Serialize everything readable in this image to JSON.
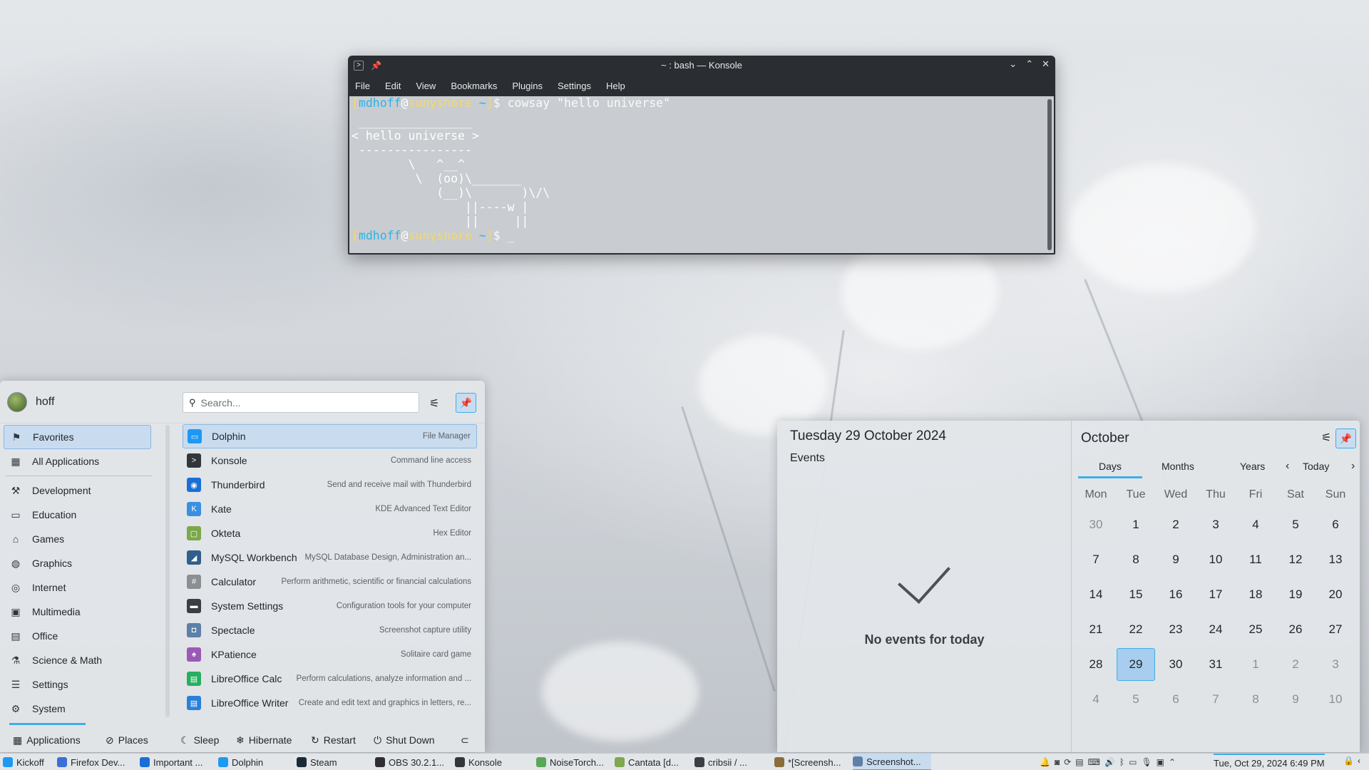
{
  "konsole": {
    "title": "~ : bash — Konsole",
    "menu": [
      "File",
      "Edit",
      "View",
      "Bookmarks",
      "Plugins",
      "Settings",
      "Help"
    ],
    "prompt": {
      "open": "[",
      "user": "mdhoff",
      "at": "@",
      "host": "sunyshore",
      "path": "~",
      "close": "]",
      "dollar": "$"
    },
    "command": " cowsay \"hello universe\"",
    "output": " ________________\n< hello universe >\n ----------------\n        \\   ^__^\n         \\  (oo)\\_______\n            (__)\\       )\\/\\\n                ||----w |\n                ||     ||",
    "cursor": " _"
  },
  "kickoff": {
    "user": "hoff",
    "search_placeholder": "Search...",
    "categories": [
      {
        "label": "Favorites",
        "icon": "bookmark-icon",
        "glyph": "⚑"
      },
      {
        "label": "All Applications",
        "icon": "grid-icon",
        "glyph": "▦"
      },
      {
        "label": "Development",
        "icon": "hammer-icon",
        "glyph": "⚒"
      },
      {
        "label": "Education",
        "icon": "education-icon",
        "glyph": "▭"
      },
      {
        "label": "Games",
        "icon": "gamepad-icon",
        "glyph": "⌂"
      },
      {
        "label": "Graphics",
        "icon": "palette-icon",
        "glyph": "◍"
      },
      {
        "label": "Internet",
        "icon": "globe-icon",
        "glyph": "◎"
      },
      {
        "label": "Multimedia",
        "icon": "multimedia-icon",
        "glyph": "▣"
      },
      {
        "label": "Office",
        "icon": "office-icon",
        "glyph": "▤"
      },
      {
        "label": "Science & Math",
        "icon": "flask-icon",
        "glyph": "⚗"
      },
      {
        "label": "Settings",
        "icon": "sliders-icon",
        "glyph": "☰"
      },
      {
        "label": "System",
        "icon": "gear-icon",
        "glyph": "⚙"
      }
    ],
    "apps": [
      {
        "name": "Dolphin",
        "desc": "File Manager",
        "color": "#1d99f3",
        "glyph": "▭"
      },
      {
        "name": "Konsole",
        "desc": "Command line access",
        "color": "#31363b",
        "glyph": ">"
      },
      {
        "name": "Thunderbird",
        "desc": "Send and receive mail with Thunderbird",
        "color": "#1a6fd6",
        "glyph": "◉"
      },
      {
        "name": "Kate",
        "desc": "KDE Advanced Text Editor",
        "color": "#3b8fe0",
        "glyph": "K"
      },
      {
        "name": "Okteta",
        "desc": "Hex Editor",
        "color": "#7aa84a",
        "glyph": "▢"
      },
      {
        "name": "MySQL Workbench",
        "desc": "MySQL Database Design, Administration an...",
        "color": "#2f5f8a",
        "glyph": "◢"
      },
      {
        "name": "Calculator",
        "desc": "Perform arithmetic, scientific or financial calculations",
        "color": "#8c8f92",
        "glyph": "#"
      },
      {
        "name": "System Settings",
        "desc": "Configuration tools for your computer",
        "color": "#3a3f44",
        "glyph": "▬"
      },
      {
        "name": "Spectacle",
        "desc": "Screenshot capture utility",
        "color": "#5e7fa6",
        "glyph": "◘"
      },
      {
        "name": "KPatience",
        "desc": "Solitaire card game",
        "color": "#9b59b6",
        "glyph": "♠"
      },
      {
        "name": "LibreOffice Calc",
        "desc": "Perform calculations, analyze information and ...",
        "color": "#27ae60",
        "glyph": "▤"
      },
      {
        "name": "LibreOffice Writer",
        "desc": "Create and edit text and graphics in letters, re...",
        "color": "#2980d9",
        "glyph": "▤"
      }
    ],
    "footer": {
      "applications": "Applications",
      "places": "Places",
      "sleep": "Sleep",
      "hibernate": "Hibernate",
      "restart": "Restart",
      "shutdown": "Shut Down"
    }
  },
  "calendar": {
    "date_heading": "Tuesday 29 October 2024",
    "events_label": "Events",
    "no_events": "No events for today",
    "month": "October",
    "tabs": [
      "Days",
      "Months",
      "Years"
    ],
    "today_label": "Today",
    "weekdays": [
      "Mon",
      "Tue",
      "Wed",
      "Thu",
      "Fri",
      "Sat",
      "Sun"
    ],
    "weeks": [
      [
        {
          "d": "30",
          "out": true
        },
        {
          "d": "1"
        },
        {
          "d": "2"
        },
        {
          "d": "3"
        },
        {
          "d": "4"
        },
        {
          "d": "5"
        },
        {
          "d": "6"
        }
      ],
      [
        {
          "d": "7"
        },
        {
          "d": "8"
        },
        {
          "d": "9"
        },
        {
          "d": "10"
        },
        {
          "d": "11"
        },
        {
          "d": "12"
        },
        {
          "d": "13"
        }
      ],
      [
        {
          "d": "14"
        },
        {
          "d": "15"
        },
        {
          "d": "16"
        },
        {
          "d": "17"
        },
        {
          "d": "18"
        },
        {
          "d": "19"
        },
        {
          "d": "20"
        }
      ],
      [
        {
          "d": "21"
        },
        {
          "d": "22"
        },
        {
          "d": "23"
        },
        {
          "d": "24"
        },
        {
          "d": "25"
        },
        {
          "d": "26"
        },
        {
          "d": "27"
        }
      ],
      [
        {
          "d": "28"
        },
        {
          "d": "29",
          "today": true
        },
        {
          "d": "30"
        },
        {
          "d": "31"
        },
        {
          "d": "1",
          "out": true
        },
        {
          "d": "2",
          "out": true
        },
        {
          "d": "3",
          "out": true
        }
      ],
      [
        {
          "d": "4",
          "out": true
        },
        {
          "d": "5",
          "out": true
        },
        {
          "d": "6",
          "out": true
        },
        {
          "d": "7",
          "out": true
        },
        {
          "d": "8",
          "out": true
        },
        {
          "d": "9",
          "out": true
        },
        {
          "d": "10",
          "out": true
        }
      ]
    ]
  },
  "taskbar": {
    "items": [
      {
        "label": "Kickoff",
        "color": "#1d99f3"
      },
      {
        "label": "Firefox Dev...",
        "color": "#3b6fd6"
      },
      {
        "label": "Important ...",
        "color": "#1a6fd6"
      },
      {
        "label": "Dolphin",
        "color": "#1d99f3"
      },
      {
        "label": "Steam",
        "color": "#1b2838"
      },
      {
        "label": "OBS 30.2.1...",
        "color": "#302e31"
      },
      {
        "label": "Konsole",
        "color": "#31363b"
      },
      {
        "label": "NoiseTorch...",
        "color": "#5aa65a"
      },
      {
        "label": "Cantata [d...",
        "color": "#7fa650"
      },
      {
        "label": "cribsii / ...",
        "color": "#3a3f44"
      },
      {
        "label": "*[Screensh...",
        "color": "#8a6d3b"
      },
      {
        "label": "Screenshot...",
        "color": "#5e7fa6"
      }
    ],
    "clock": "Tue, Oct 29, 2024 6:49 PM"
  }
}
